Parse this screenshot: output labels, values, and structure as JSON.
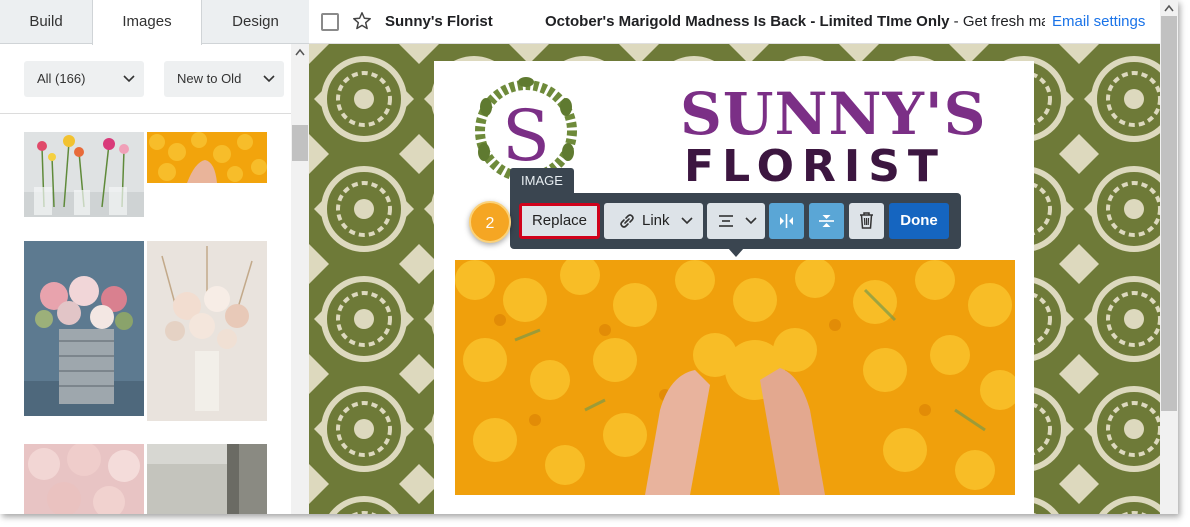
{
  "tabs": [
    {
      "label": "Build"
    },
    {
      "label": "Images"
    },
    {
      "label": "Design"
    }
  ],
  "filters": {
    "category": "All (166)",
    "sort": "New to Old"
  },
  "email": {
    "sender": "Sunny's Florist",
    "subject": "October's Marigold Madness Is Back - Limited TIme Only",
    "preview": " - Get fresh mari…",
    "settings_link": "Email settings"
  },
  "logo": {
    "monogram": "S",
    "line1": "SUNNY'S",
    "line2": "FLORIST"
  },
  "image_toolbar": {
    "tag": "IMAGE",
    "replace": "Replace",
    "link": "Link",
    "done": "Done",
    "step_badge": "2"
  },
  "colors": {
    "accent": "#1565c0",
    "highlight": "#d0021b",
    "badge": "#f5a623",
    "brand_purple": "#7b2f86",
    "pattern_green": "#6e7a38"
  }
}
